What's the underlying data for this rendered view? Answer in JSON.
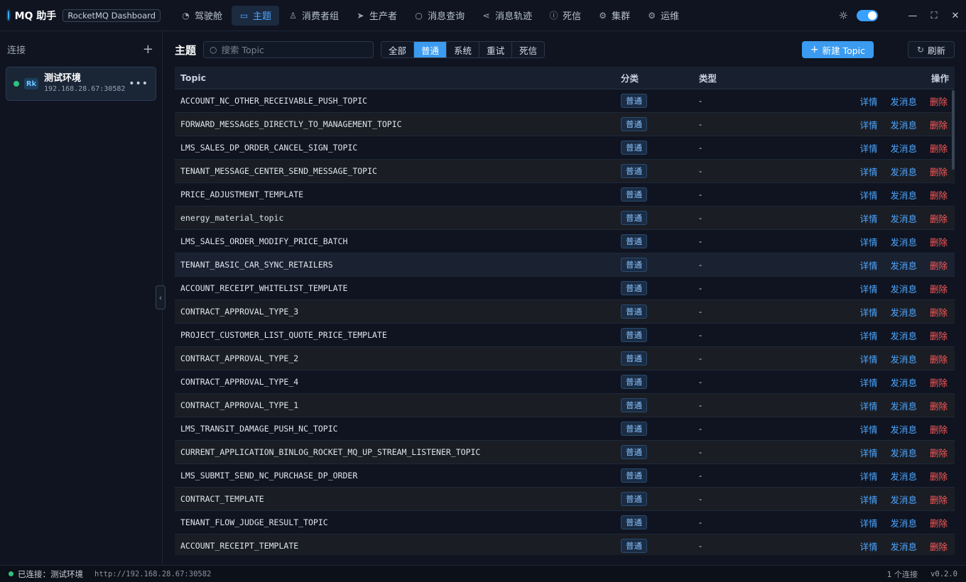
{
  "app": {
    "name": "MQ 助手",
    "badge": "RocketMQ Dashboard"
  },
  "nav": [
    {
      "label": "驾驶舱",
      "icon": "dashboard-icon",
      "glyph": "◔"
    },
    {
      "label": "主题",
      "icon": "folder-icon",
      "glyph": "▭",
      "active": true
    },
    {
      "label": "消费者组",
      "icon": "user-icon",
      "glyph": "♙"
    },
    {
      "label": "生产者",
      "icon": "send-icon",
      "glyph": "➤"
    },
    {
      "label": "消息查询",
      "icon": "search-icon",
      "glyph": "○"
    },
    {
      "label": "消息轨迹",
      "icon": "share-icon",
      "glyph": "⋖"
    },
    {
      "label": "死信",
      "icon": "alert-icon",
      "glyph": "ⓘ"
    },
    {
      "label": "集群",
      "icon": "cluster-icon",
      "glyph": "⚙"
    },
    {
      "label": "运维",
      "icon": "gear-icon",
      "glyph": "⚙"
    }
  ],
  "sidebar": {
    "title": "连接",
    "connection": {
      "abbr": "Rk",
      "name": "测试环境",
      "host": "192.168.28.67:30582"
    }
  },
  "toolbar": {
    "title": "主题",
    "search_placeholder": "搜索 Topic",
    "filters": [
      "全部",
      "普通",
      "系统",
      "重试",
      "死信"
    ],
    "active_filter": "普通",
    "new_label": "新建 Topic",
    "refresh_label": "刷新"
  },
  "table": {
    "headers": {
      "topic": "Topic",
      "category": "分类",
      "type": "类型",
      "ops": "操作"
    },
    "ops": {
      "detail": "详情",
      "send": "发消息",
      "delete": "删除"
    },
    "rows": [
      {
        "topic": "ACCOUNT_NC_OTHER_RECEIVABLE_PUSH_TOPIC",
        "category": "普通",
        "type": "-"
      },
      {
        "topic": "FORWARD_MESSAGES_DIRECTLY_TO_MANAGEMENT_TOPIC",
        "category": "普通",
        "type": "-"
      },
      {
        "topic": "LMS_SALES_DP_ORDER_CANCEL_SIGN_TOPIC",
        "category": "普通",
        "type": "-"
      },
      {
        "topic": "TENANT_MESSAGE_CENTER_SEND_MESSAGE_TOPIC",
        "category": "普通",
        "type": "-"
      },
      {
        "topic": "PRICE_ADJUSTMENT_TEMPLATE",
        "category": "普通",
        "type": "-"
      },
      {
        "topic": "energy_material_topic",
        "category": "普通",
        "type": "-"
      },
      {
        "topic": "LMS_SALES_ORDER_MODIFY_PRICE_BATCH",
        "category": "普通",
        "type": "-"
      },
      {
        "topic": "TENANT_BASIC_CAR_SYNC_RETAILERS",
        "category": "普通",
        "type": "-"
      },
      {
        "topic": "ACCOUNT_RECEIPT_WHITELIST_TEMPLATE",
        "category": "普通",
        "type": "-"
      },
      {
        "topic": "CONTRACT_APPROVAL_TYPE_3",
        "category": "普通",
        "type": "-"
      },
      {
        "topic": "PROJECT_CUSTOMER_LIST_QUOTE_PRICE_TEMPLATE",
        "category": "普通",
        "type": "-"
      },
      {
        "topic": "CONTRACT_APPROVAL_TYPE_2",
        "category": "普通",
        "type": "-"
      },
      {
        "topic": "CONTRACT_APPROVAL_TYPE_4",
        "category": "普通",
        "type": "-"
      },
      {
        "topic": "CONTRACT_APPROVAL_TYPE_1",
        "category": "普通",
        "type": "-"
      },
      {
        "topic": "LMS_TRANSIT_DAMAGE_PUSH_NC_TOPIC",
        "category": "普通",
        "type": "-"
      },
      {
        "topic": "CURRENT_APPLICATION_BINLOG_ROCKET_MQ_UP_STREAM_LISTENER_TOPIC",
        "category": "普通",
        "type": "-"
      },
      {
        "topic": "LMS_SUBMIT_SEND_NC_PURCHASE_DP_ORDER",
        "category": "普通",
        "type": "-"
      },
      {
        "topic": "CONTRACT_TEMPLATE",
        "category": "普通",
        "type": "-"
      },
      {
        "topic": "TENANT_FLOW_JUDGE_RESULT_TOPIC",
        "category": "普通",
        "type": "-"
      },
      {
        "topic": "ACCOUNT_RECEIPT_TEMPLATE",
        "category": "普通",
        "type": "-"
      }
    ]
  },
  "status": {
    "connected_text": "已连接：测试环境",
    "url": "http://192.168.28.67:30582",
    "connections": "1 个连接",
    "version": "v0.2.0"
  },
  "colors": {
    "accent": "#3a9bf0",
    "danger": "#ff5a5a",
    "online": "#2ec27e",
    "background": "#0f1420"
  }
}
